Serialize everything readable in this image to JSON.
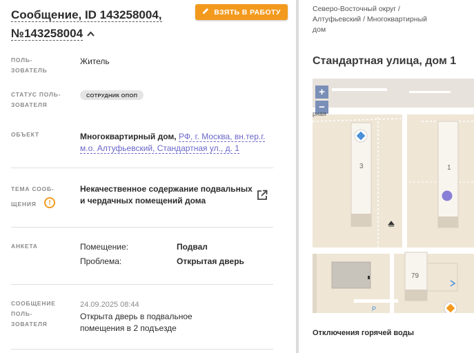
{
  "message": {
    "title_part1": "Сообщение, ID 143258004,",
    "title_part2": "№143258004",
    "take_button": "ВЗЯТЬ В РАБОТУ"
  },
  "fields": {
    "user_label_1": "ПОЛЬ-",
    "user_label_2": "ЗОВАТЕЛЬ",
    "user_value": "Житель",
    "status_label_1": "СТАТУС ПОЛЬ-",
    "status_label_2": "ЗОВАТЕЛЯ",
    "status_badge": "СОТРУДНИК ОПОП",
    "object_label": "ОБЪЕКТ",
    "object_type": "Многоквартирный дом,",
    "object_link_1": "РФ, г. Москва, вн.тер.г.",
    "object_link_2": "м.о. Алтуфьевский, Стандартная ул., д. 1",
    "topic_label_1": "ТЕМА СООБ-",
    "topic_label_2": "ЩЕНИЯ",
    "topic_line_1": "Некачественное содержание подвальных",
    "topic_line_2": "и чердачных помещений дома",
    "survey_label": "АНКЕТА",
    "room_label": "Помещение:",
    "room_value": "Подвал",
    "problem_label": "Проблема:",
    "problem_value": "Открытая дверь",
    "msg_label_1": "СООБЩЕНИЕ",
    "msg_label_2": "ПОЛЬ-",
    "msg_label_3": "ЗОВАТЕЛЯ",
    "msg_date": "24.09.2025 08:44",
    "msg_line_1": "Открыта дверь в подвальное",
    "msg_line_2": "помещения в 2 подъезде"
  },
  "right": {
    "crumb_1": "Северо-Восточный округ /",
    "crumb_2": "Алтуфьевский / Многоквартирный",
    "crumb_3": "дом",
    "address": "Стандартная улица, дом 1",
    "outage": "Отключения горячей воды"
  },
  "map": {
    "zoom_in": "+",
    "zoom_out": "−",
    "label_rnaya": "рная",
    "bld_3": "3",
    "bld_1": "1",
    "bld_79": "79",
    "parking": "P"
  },
  "colors": {
    "accent": "#f39a1e",
    "link": "#6a66c8",
    "marker": "#8a7fd6",
    "map_zoom": "#7a8fb8"
  }
}
